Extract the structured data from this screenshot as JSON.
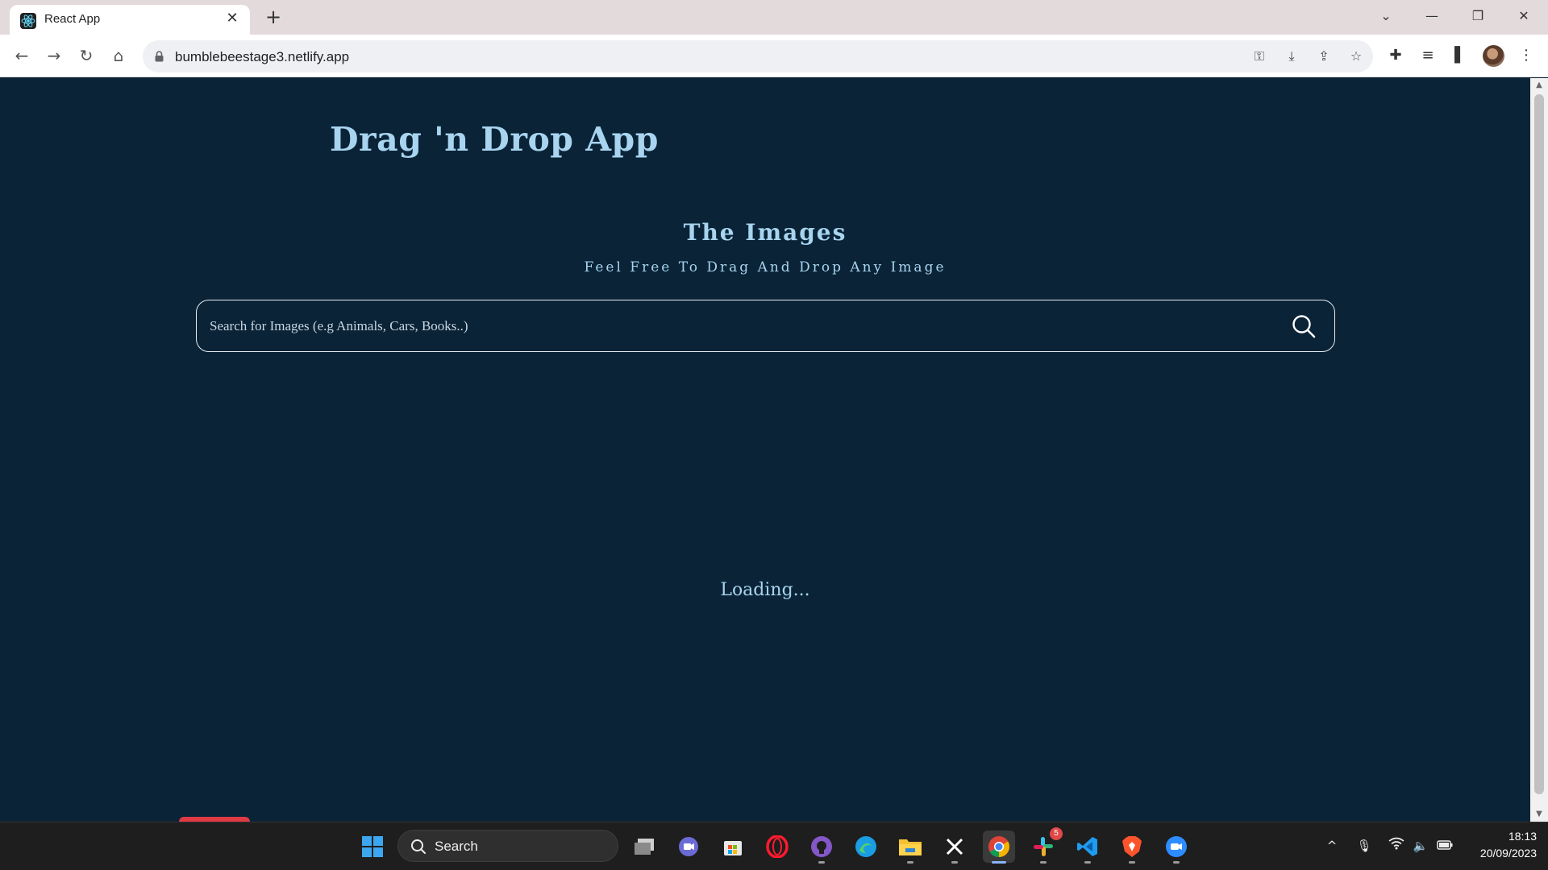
{
  "browser": {
    "tab_title": "React App",
    "url": "bumblebeestage3.netlify.app"
  },
  "page": {
    "app_title": "Drag 'n Drop App",
    "section_title": "The Images",
    "section_subtitle": "Feel Free To Drag And Drop Any Image",
    "search_placeholder": "Search for Images (e.g Animals, Cars, Books..)",
    "search_value": "",
    "loading_text": "Loading..."
  },
  "colors": {
    "page_background": "#0a2337",
    "heading_text": "#a8d4ef",
    "search_border": "#e6eef4"
  },
  "taskbar": {
    "search_label": "Search",
    "apps": [
      "windows-start",
      "file-explorer-multi",
      "teams",
      "microsoft-store",
      "opera",
      "github-desktop",
      "edge",
      "file-explorer",
      "x",
      "chrome",
      "slack",
      "vscode",
      "brave",
      "zoom"
    ],
    "slack_badge": "5",
    "time": "18:13",
    "date": "20/09/2023"
  }
}
